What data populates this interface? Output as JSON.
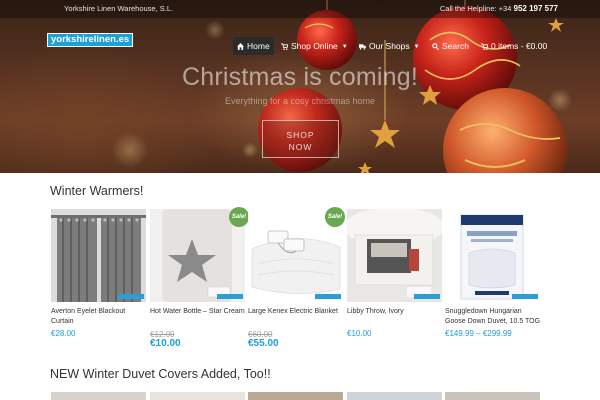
{
  "topbar": {
    "company": "Yorkshire Linen Warehouse, S.L.",
    "helpline_label": "Call the Helpline:",
    "helpline_prefix": "+34",
    "helpline_number": "952 197 577"
  },
  "logo": {
    "text": "yorkshirelinen.es"
  },
  "nav": {
    "home": "Home",
    "shop_online": "Shop Online",
    "our_shops": "Our Shops",
    "search": "Search",
    "cart": "0 items - €0.00"
  },
  "hero": {
    "title": "Christmas is coming!",
    "subtitle": "Everything for a cosy christmas home",
    "cta_line1": "SHOP",
    "cta_line2": "NOW"
  },
  "sections": {
    "winter_title": "Winter Warmers!",
    "duvet_title": "NEW Winter Duvet Covers Added, Too!!"
  },
  "products": [
    {
      "name": "Averton Eyelet Blackout Curtain",
      "price": "€28.00",
      "sale": false
    },
    {
      "name": "Hot Water Bottle – Star Cream",
      "old_price": "€12.00",
      "price": "€10.00",
      "sale": true,
      "sale_label": "Sale!"
    },
    {
      "name": "Large Kenex Electric Blanket",
      "old_price": "€60.00",
      "price": "€55.00",
      "sale": true,
      "sale_label": "Sale!"
    },
    {
      "name": "Libby Throw, Ivory",
      "price": "€10.00",
      "sale": false
    },
    {
      "name": "Snuggledown Hungarian Goose Down Duvet, 10.5 TOG",
      "price": "€149.99 – €299.99",
      "sale": false
    }
  ],
  "colors": {
    "accent": "#1ba0d8",
    "sale_badge": "#6aa84f",
    "nav_active": "#2b2b2b"
  }
}
